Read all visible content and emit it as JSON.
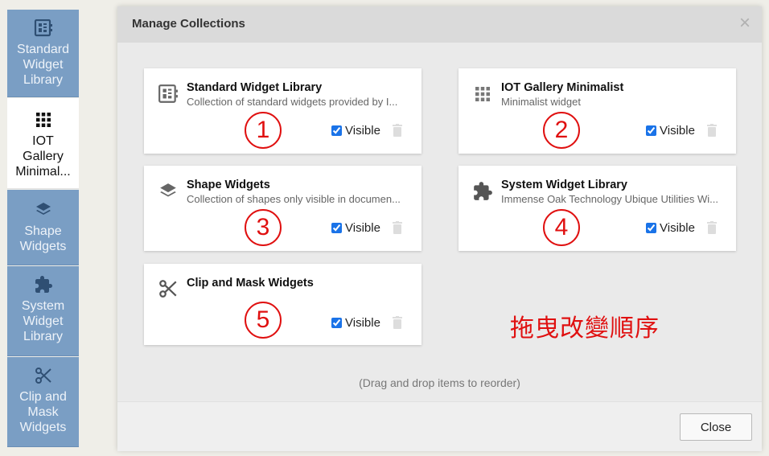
{
  "sidebar": {
    "items": [
      {
        "label_lines": [
          "Standard",
          "Widget",
          "Library"
        ],
        "icon": "widget-library-icon",
        "active": false
      },
      {
        "label_lines": [
          "IOT",
          "Gallery",
          "Minimal..."
        ],
        "icon": "grid-icon",
        "active": true
      },
      {
        "label_lines": [
          "Shape",
          "Widgets"
        ],
        "icon": "layers-icon",
        "active": false
      },
      {
        "label_lines": [
          "System",
          "Widget",
          "Library"
        ],
        "icon": "puzzle-icon",
        "active": false
      },
      {
        "label_lines": [
          "Clip and",
          "Mask",
          "Widgets"
        ],
        "icon": "scissors-icon",
        "active": false
      }
    ]
  },
  "modal": {
    "title": "Manage Collections",
    "close_glyph": "×",
    "hint": "(Drag and drop items to reorder)",
    "close_button_label": "Close",
    "annotation": "拖曳改變順序"
  },
  "cards": [
    {
      "title": "Standard Widget Library",
      "description": "Collection of standard widgets provided by I...",
      "visible_label": "Visible",
      "visible": true,
      "icon": "widget-library-icon",
      "number": "1"
    },
    {
      "title": "IOT Gallery Minimalist",
      "description": "Minimalist widget",
      "visible_label": "Visible",
      "visible": true,
      "icon": "grid-icon",
      "number": "2"
    },
    {
      "title": "Shape Widgets",
      "description": "Collection of shapes only visible in documen...",
      "visible_label": "Visible",
      "visible": true,
      "icon": "layers-icon",
      "number": "3"
    },
    {
      "title": "System Widget Library",
      "description": "Immense Oak Technology Ubique Utilities Wi...",
      "visible_label": "Visible",
      "visible": true,
      "icon": "puzzle-icon",
      "number": "4"
    },
    {
      "title": "Clip and Mask Widgets",
      "description": "",
      "visible_label": "Visible",
      "visible": true,
      "icon": "scissors-icon",
      "number": "5"
    }
  ],
  "colors": {
    "sidebar_blue": "#7a9ec4",
    "annotation_red": "#e01010",
    "checkbox_blue": "#1a73e8"
  }
}
